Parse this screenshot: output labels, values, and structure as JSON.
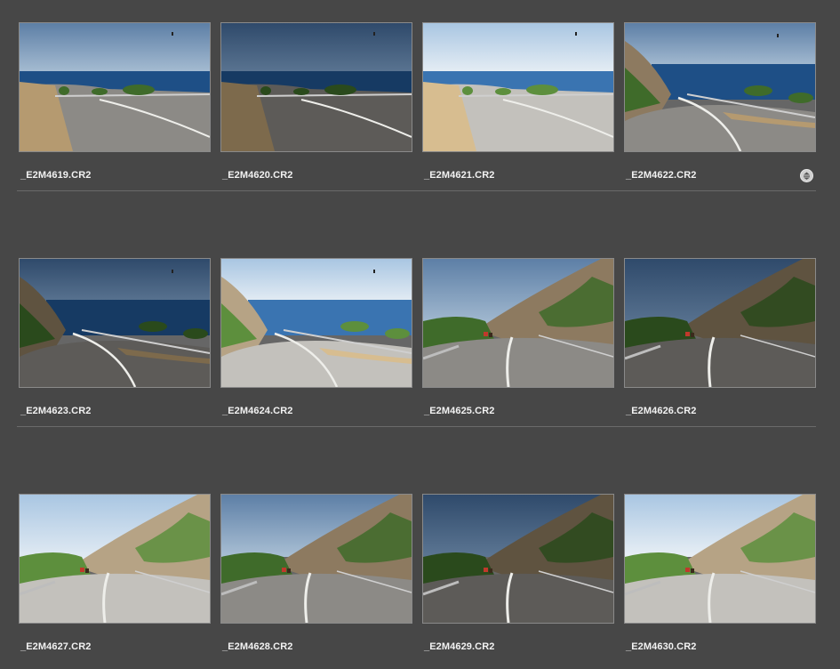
{
  "browser": {
    "rows": [
      {
        "items": [
          {
            "filename": "_E2M4619.CR2",
            "scene": "coast",
            "tone": "normal"
          },
          {
            "filename": "_E2M4620.CR2",
            "scene": "coast",
            "tone": "dark"
          },
          {
            "filename": "_E2M4621.CR2",
            "scene": "coast",
            "tone": "bright"
          },
          {
            "filename": "_E2M4622.CR2",
            "scene": "coast-cliff",
            "tone": "normal",
            "badge": "stack-icon"
          }
        ]
      },
      {
        "items": [
          {
            "filename": "_E2M4623.CR2",
            "scene": "coast-cliff",
            "tone": "dark"
          },
          {
            "filename": "_E2M4624.CR2",
            "scene": "coast-cliff",
            "tone": "bright"
          },
          {
            "filename": "_E2M4625.CR2",
            "scene": "hill-road",
            "tone": "normal"
          },
          {
            "filename": "_E2M4626.CR2",
            "scene": "hill-road",
            "tone": "dark"
          }
        ]
      },
      {
        "items": [
          {
            "filename": "_E2M4627.CR2",
            "scene": "hill-road-wide",
            "tone": "bright"
          },
          {
            "filename": "_E2M4628.CR2",
            "scene": "hill-road-low",
            "tone": "normal"
          },
          {
            "filename": "_E2M4629.CR2",
            "scene": "hill-road-low",
            "tone": "dark"
          },
          {
            "filename": "_E2M4630.CR2",
            "scene": "hill-road-low",
            "tone": "bright"
          }
        ]
      }
    ]
  },
  "colors": {
    "background": "#474747",
    "separator": "#6a6a6a",
    "thumb_border": "#8a8a8a",
    "filename_text": "#f2f2f2"
  }
}
